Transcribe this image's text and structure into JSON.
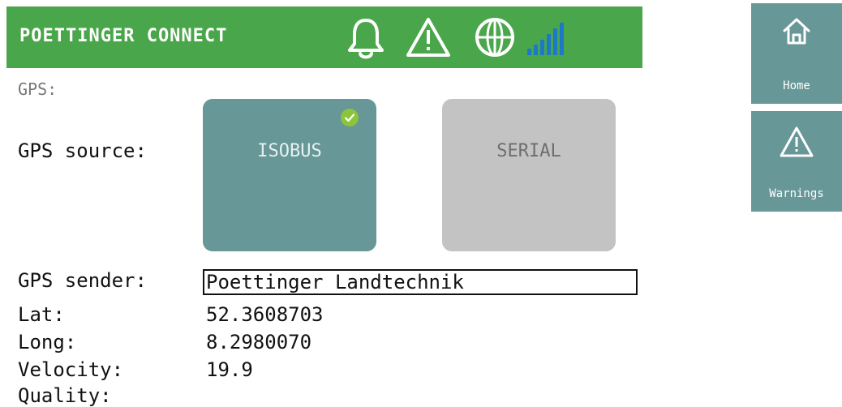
{
  "header": {
    "title": "POETTINGER CONNECT",
    "icons": [
      "bell-icon",
      "warning-icon",
      "globe-icon",
      "signal-strength-icon"
    ]
  },
  "gps": {
    "section_label": "GPS:",
    "source_label": "GPS source:",
    "sources": [
      {
        "label": "ISOBUS",
        "selected": true
      },
      {
        "label": "SERIAL",
        "selected": false
      }
    ],
    "sender_label": "GPS sender:",
    "sender_value": "Poettinger Landtechnik",
    "lat_label": "Lat:",
    "lat_value": "52.3608703",
    "long_label": "Long:",
    "long_value": "8.2980070",
    "velocity_label": "Velocity:",
    "velocity_value": "19.9",
    "quality_label": "Quality:"
  },
  "sidebar": {
    "items": [
      {
        "label": "Home",
        "icon": "home-icon"
      },
      {
        "label": "Warnings",
        "icon": "warning-icon"
      }
    ]
  },
  "colors": {
    "header_bg": "#4aa64a",
    "selected_button": "#679797",
    "unselected_button": "#c3c3c3",
    "check": "#8cc43c",
    "signal": "#1e78c8"
  }
}
